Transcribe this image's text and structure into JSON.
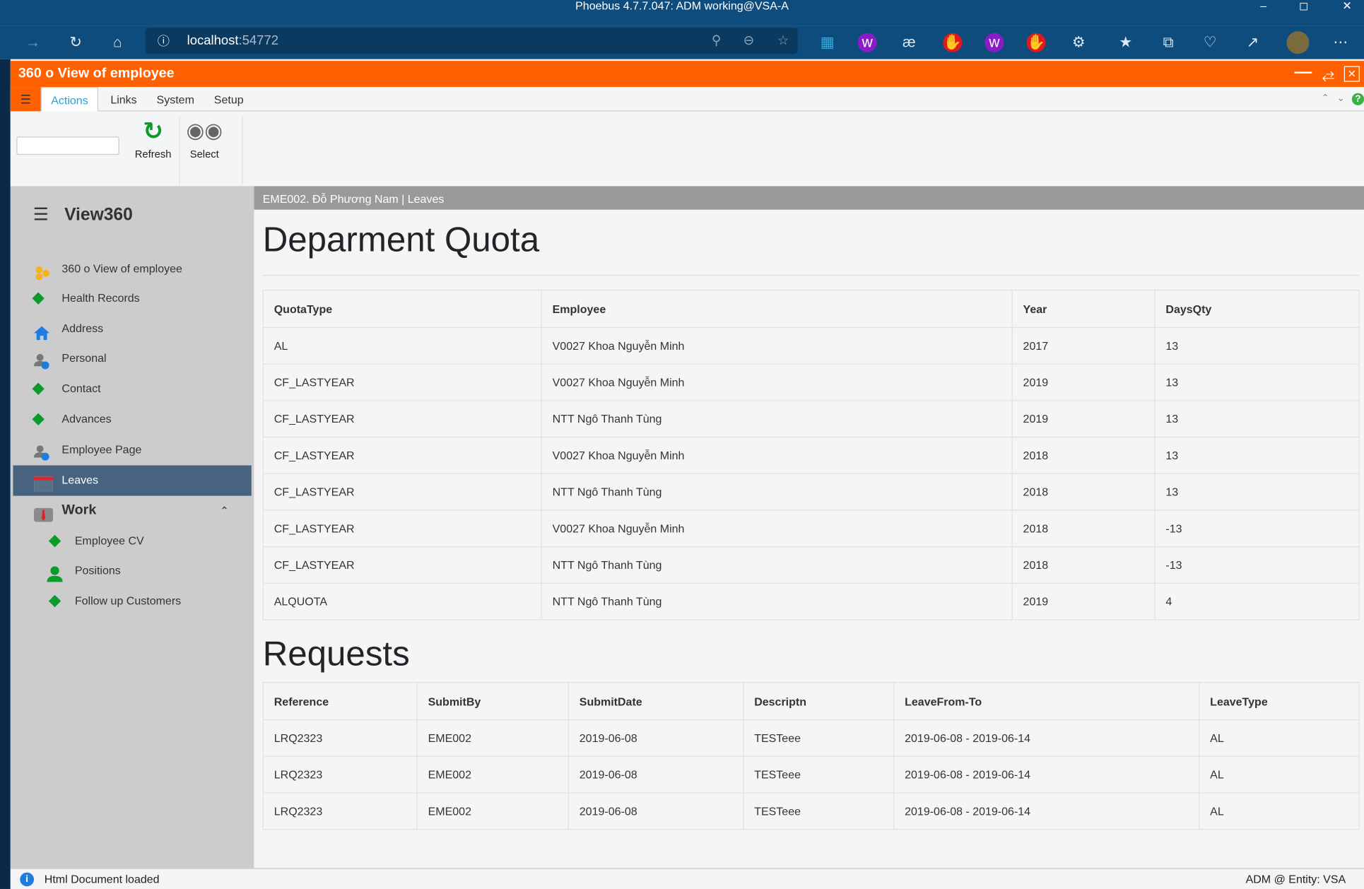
{
  "window": {
    "title": "Phoebus 4.7.7.047: ADM working@VSA-A"
  },
  "browser": {
    "address_host": "localhost",
    "address_port": ":54772"
  },
  "app": {
    "title": "360 o View of employee",
    "accent": "#ff6000"
  },
  "menu": {
    "tabs": [
      "Actions",
      "Links",
      "System",
      "Setup"
    ]
  },
  "ribbon": {
    "search_value": "",
    "refresh_label": "Refresh",
    "select_label": "Select"
  },
  "sidebar": {
    "title": "View360",
    "items": [
      {
        "label": "360 o View of employee",
        "icon": "hexagons-icon"
      },
      {
        "label": "Health Records",
        "icon": "diamond-icon"
      },
      {
        "label": "Address",
        "icon": "home-icon"
      },
      {
        "label": "Personal",
        "icon": "user-info-icon"
      },
      {
        "label": "Contact",
        "icon": "diamond-icon"
      },
      {
        "label": "Advances",
        "icon": "diamond-icon"
      },
      {
        "label": "Employee Page",
        "icon": "user-info-icon"
      },
      {
        "label": "Leaves",
        "icon": "calendar-icon",
        "active": true
      }
    ],
    "group": {
      "label": "Work",
      "icon": "suit-icon",
      "items": [
        {
          "label": "Employee CV",
          "icon": "diamond-icon"
        },
        {
          "label": "Positions",
          "icon": "user-icon"
        },
        {
          "label": "Follow up Customers",
          "icon": "diamond-icon"
        }
      ]
    }
  },
  "main": {
    "breadcrumb": "EME002. Đỗ Phương Nam | Leaves",
    "quota": {
      "title": "Deparment Quota",
      "columns": [
        "QuotaType",
        "Employee",
        "Year",
        "DaysQty"
      ],
      "rows": [
        [
          "AL",
          "V0027 Khoa Nguyễn Minh",
          "2017",
          "13"
        ],
        [
          "CF_LASTYEAR",
          "V0027 Khoa Nguyễn Minh",
          "2019",
          "13"
        ],
        [
          "CF_LASTYEAR",
          "NTT Ngô Thanh Tùng",
          "2019",
          "13"
        ],
        [
          "CF_LASTYEAR",
          "V0027 Khoa Nguyễn Minh",
          "2018",
          "13"
        ],
        [
          "CF_LASTYEAR",
          "NTT Ngô Thanh Tùng",
          "2018",
          "13"
        ],
        [
          "CF_LASTYEAR",
          "V0027 Khoa Nguyễn Minh",
          "2018",
          "-13"
        ],
        [
          "CF_LASTYEAR",
          "NTT Ngô Thanh Tùng",
          "2018",
          "-13"
        ],
        [
          "ALQUOTA",
          "NTT Ngô Thanh Tùng",
          "2019",
          "4"
        ]
      ]
    },
    "requests": {
      "title": "Requests",
      "columns": [
        "Reference",
        "SubmitBy",
        "SubmitDate",
        "Descriptn",
        "LeaveFrom-To",
        "LeaveType"
      ],
      "rows": [
        [
          "LRQ2323",
          "EME002",
          "2019-06-08",
          "TESTeee",
          "2019-06-08 - 2019-06-14",
          "AL"
        ],
        [
          "LRQ2323",
          "EME002",
          "2019-06-08",
          "TESTeee",
          "2019-06-08 - 2019-06-14",
          "AL"
        ],
        [
          "LRQ2323",
          "EME002",
          "2019-06-08",
          "TESTeee",
          "2019-06-08 - 2019-06-14",
          "AL"
        ]
      ]
    }
  },
  "status": {
    "message": "Html Document loaded",
    "right": "ADM @ Entity: VSA"
  }
}
